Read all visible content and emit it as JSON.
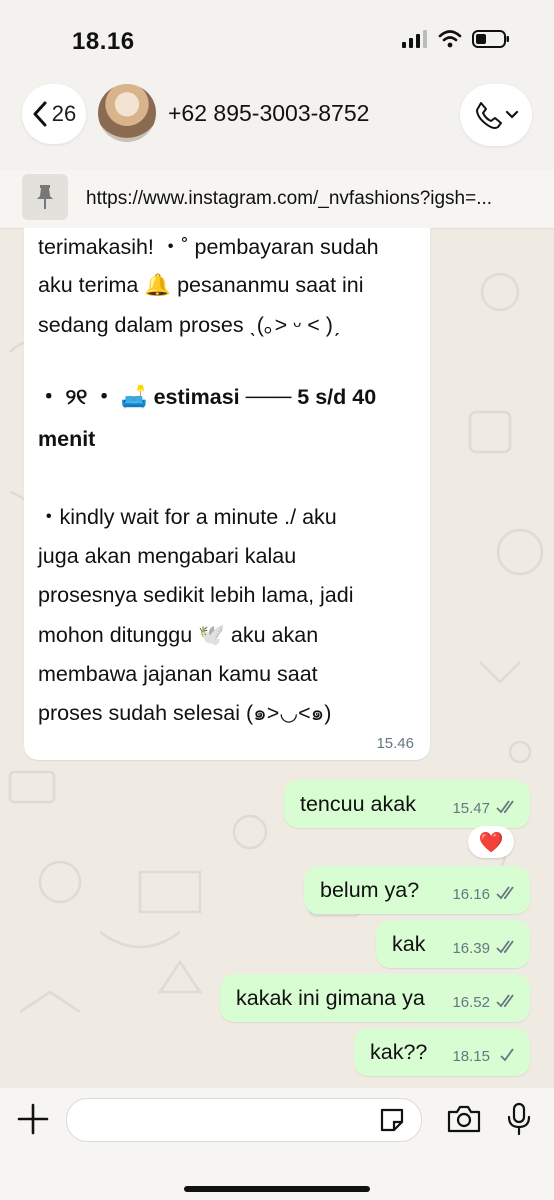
{
  "status": {
    "time": "18.16"
  },
  "header": {
    "back_count": "26",
    "contact": "+62 895-3003-8752"
  },
  "pinned": {
    "link": "https://www.instagram.com/_nvfashions?igsh=..."
  },
  "incoming": {
    "lines": [
      "terimakasih! ・˚ pembayaran sudah",
      "aku terima 🔔 pesananmu saat ini",
      "sedang dalam proses ˎ(｡˃ ᵕ ˂ )ˏ",
      "・ ୨୧ ・ 🛋️ estimasi ─── 5 s/d 40",
      "menit",
      "・kindly wait for a minute ./ aku",
      "juga akan mengabari kalau",
      "prosesnya sedikit lebih lama,  jadi",
      "mohon ditunggu 🕊️ aku akan",
      "membawa jajanan kamu saat",
      "proses sudah selesai (๑>◡<๑)"
    ],
    "time": "15.46"
  },
  "outgoing": [
    {
      "text": "tencuu akak",
      "time": "15.47",
      "status": "read"
    },
    {
      "text": "belum ya?",
      "time": "16.16",
      "status": "read"
    },
    {
      "text": "kak",
      "time": "16.39",
      "status": "read"
    },
    {
      "text": "kakak ini gimana ya",
      "time": "16.52",
      "status": "read"
    },
    {
      "text": "kak??",
      "time": "18.15",
      "status": "sent"
    }
  ],
  "reaction": {
    "emoji": "❤️"
  },
  "colors": {
    "outgoing_bubble": "#d9fdd3",
    "incoming_bubble": "#ffffff",
    "background": "#efeae2",
    "read_tick": "#667781"
  }
}
